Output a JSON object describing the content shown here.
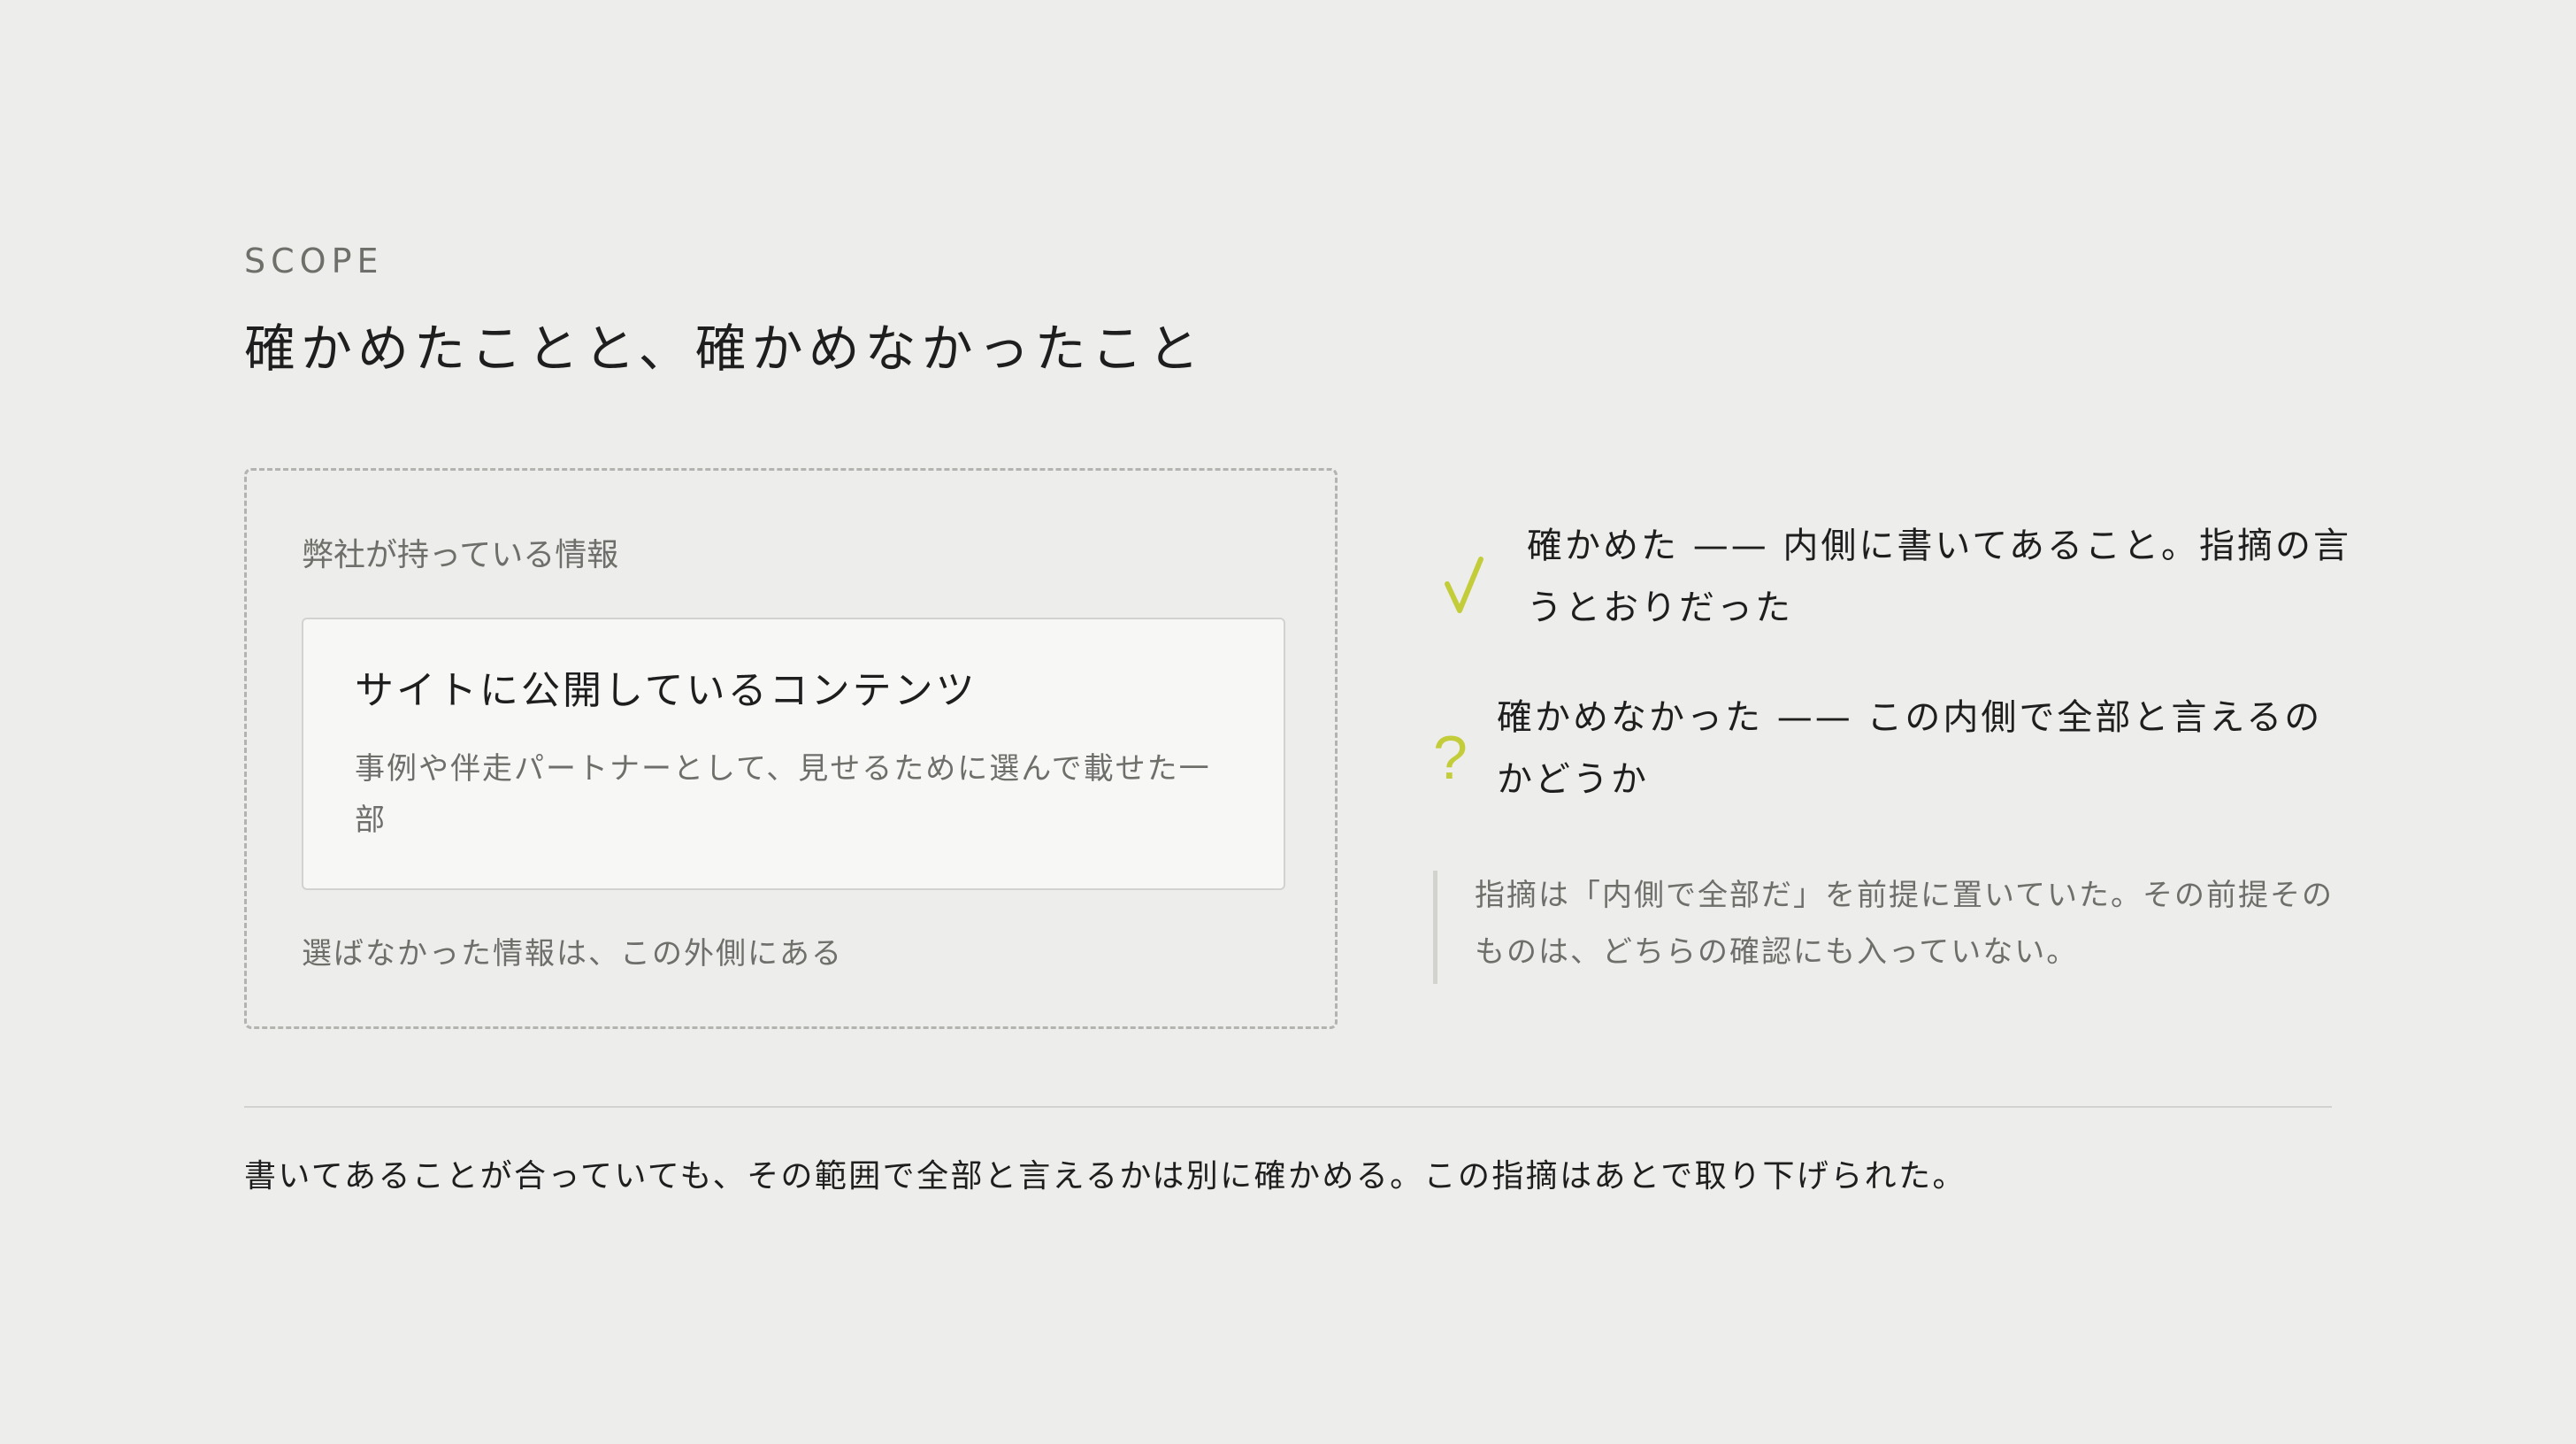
{
  "header": {
    "eyebrow": "SCOPE",
    "title": "確かめたことと、確かめなかったこと"
  },
  "scope_box": {
    "label": "弊社が持っている情報",
    "card": {
      "title": "サイトに公開しているコンテンツ",
      "description": "事例や伴走パートナーとして、見せるために選んで載せた一部"
    },
    "outside_note": "選ばなかった情報は、この外側にある"
  },
  "findings": [
    {
      "icon": "check-icon",
      "icon_color": "#c3cd3a",
      "text": "確かめた —— 内側に書いてあること。指摘の言うとおりだった"
    },
    {
      "icon": "question-icon",
      "icon_glyph": "?",
      "icon_color": "#c3cd3a",
      "text": "確かめなかった —— この内側で全部と言えるのかどうか"
    }
  ],
  "note": "指摘は「内側で全部だ」を前提に置いていた。その前提そのものは、どちらの確認にも入っていない。",
  "conclusion": "書いてあることが合っていても、その範囲で全部と言えるかは別に確かめる。この指摘はあとで取り下げられた。"
}
